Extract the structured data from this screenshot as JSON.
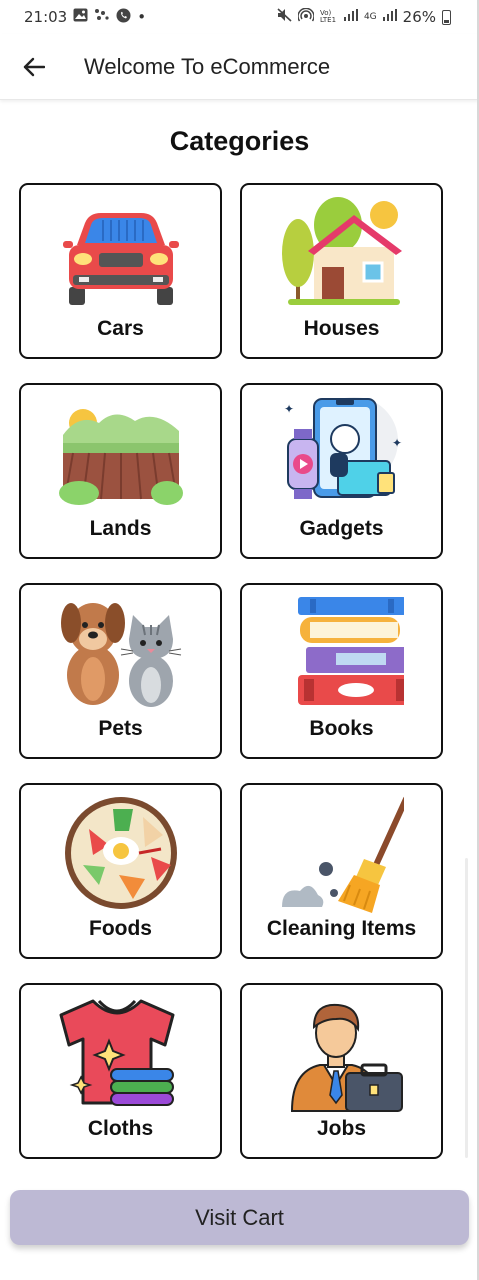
{
  "status_bar": {
    "time": "21:03",
    "dot": "•",
    "network_label": "Vo) LTE1",
    "network_type": "4G",
    "battery": "26%",
    "icons": [
      "gallery-icon",
      "dots-icon",
      "whatsapp-icon",
      "mute-icon",
      "hotspot-icon",
      "signal-icon",
      "battery-icon"
    ]
  },
  "app_bar": {
    "title": "Welcome To eCommerce",
    "back_icon": "arrow-left-icon"
  },
  "section_title": "Categories",
  "categories": [
    {
      "label": "Cars",
      "icon": "car-icon"
    },
    {
      "label": "Houses",
      "icon": "house-icon"
    },
    {
      "label": "Lands",
      "icon": "land-icon"
    },
    {
      "label": "Gadgets",
      "icon": "gadgets-icon"
    },
    {
      "label": "Pets",
      "icon": "pets-icon"
    },
    {
      "label": "Books",
      "icon": "books-icon"
    },
    {
      "label": "Foods",
      "icon": "food-bowl-icon"
    },
    {
      "label": "Cleaning Items",
      "icon": "broom-icon"
    },
    {
      "label": "Cloths",
      "icon": "shirt-icon"
    },
    {
      "label": "Jobs",
      "icon": "businessman-icon"
    }
  ],
  "cart_button": {
    "label": "Visit Cart"
  },
  "colors": {
    "cart_button": "#bdb9d4",
    "card_border": "#111111",
    "background": "#ffffff"
  }
}
